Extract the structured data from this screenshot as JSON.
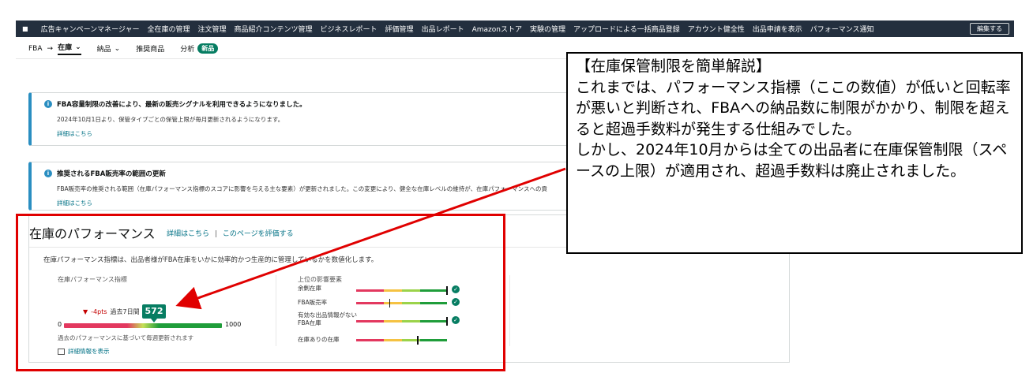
{
  "topnav": {
    "items": [
      "広告キャンペーンマネージャー",
      "全在庫の管理",
      "注文管理",
      "商品紹介コンテンツ管理",
      "ビジネスレポート",
      "評価管理",
      "出品レポート",
      "Amazonストア",
      "実験の管理",
      "アップロードによる一括商品登録",
      "アカウント健全性",
      "出品申請を表示",
      "パフォーマンス通知"
    ],
    "edit_label": "編集する"
  },
  "subnav": {
    "fba": "FBA",
    "arrow": "→",
    "inventory": "在庫",
    "shipments": "納品",
    "recommended": "推奨商品",
    "analytics": "分析",
    "new_badge": "新品"
  },
  "alerts": [
    {
      "title": "FBA容量制限の改善により、最新の販売シグナルを利用できるようになりました。",
      "body": "2024年10月1日より、保管タイプごとの保管上限が毎月更新されるようになります。",
      "link": "詳細はこちら"
    },
    {
      "title": "推奨されるFBA販売率の範囲の更新",
      "body": "FBA販売率の推奨される範囲（在庫パフォーマンス指標のスコアに影響を与える主な要素）が更新されました。この変更により、健全な在庫レベルの維持が、在庫パフォーマンスへの貢",
      "link": "詳細はこちら"
    }
  ],
  "performance": {
    "title": "在庫のパフォーマンス",
    "link_details": "詳細はこちら",
    "link_sep": "|",
    "link_rate": "このページを評価する",
    "description": "在庫パフォーマンス指標は、出品者様がFBA在庫をいかに効率的かつ生産的に管理しているかを数値化します。",
    "ipi_label": "在庫パフォーマンス指標",
    "change": "-4pts",
    "period": "過去7日間",
    "score": "572",
    "score_value": 572,
    "min": "0",
    "max": "1000",
    "update_note": "過去のパフォーマンスに基づいて毎週更新されます",
    "detail_link": "詳細情報を表示",
    "factors_label": "上位の影響要素",
    "factors": [
      {
        "label": "余剰在庫",
        "marker": 1.0,
        "ok": true
      },
      {
        "label": "FBA販売率",
        "marker": 0.37,
        "ok": true
      },
      {
        "label": "有効な出品情報がないFBA在庫",
        "marker": 1.0,
        "ok": true
      },
      {
        "label": "在庫ありの在庫",
        "marker": 0.68,
        "ok": false
      }
    ],
    "colors": {
      "red": "#e3385f",
      "yellow": "#f5c242",
      "lightgreen": "#9bd34a",
      "green": "#1f9d3a"
    }
  },
  "callout": {
    "text": "【在庫保管制限を簡単解説】\nこれまでは、パフォーマンス指標（ここの数値）が低いと回転率が悪いと判断され、FBAへの納品数に制限がかかり、制限を超えると超過手数料が発生する仕組みでした。\nしかし、2024年10月からは全ての出品者に在庫保管制限（スペースの上限）が適用され、超過手数料は廃止されました。"
  },
  "annotation_color": "#e00000"
}
